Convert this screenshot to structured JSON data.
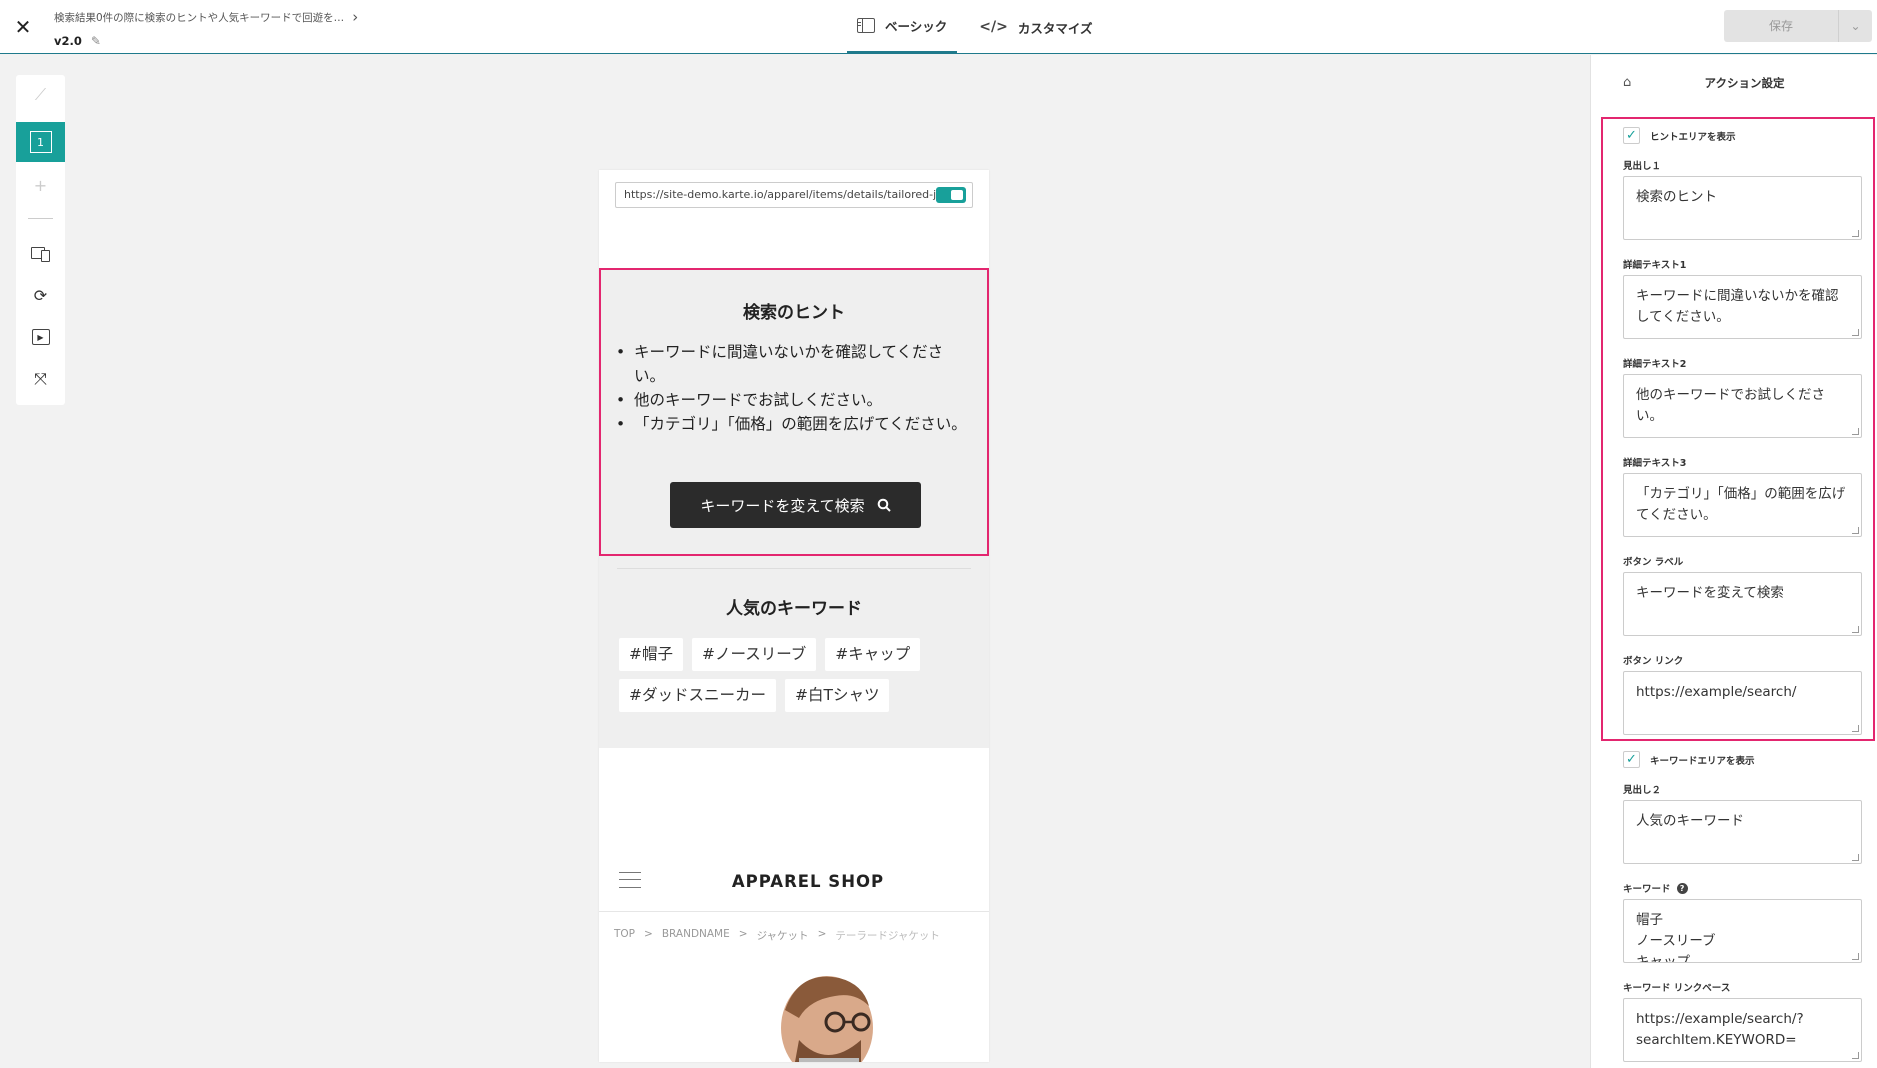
{
  "header": {
    "title": "検索結果0件の際に検索のヒントや人気キーワードで回遊を…",
    "version": "v2.0",
    "tabs": [
      {
        "label": "ベーシック",
        "active": true
      },
      {
        "label": "カスタマイズ",
        "active": false
      }
    ],
    "save_label": "保存"
  },
  "left_toolbar": {
    "active_page": "1",
    "add_label": "+"
  },
  "preview": {
    "url": "https://site-demo.karte.io/apparel/items/details/tailored-jacket",
    "hint": {
      "title": "検索のヒント",
      "items": [
        "キーワードに間違いないかを確認してください。",
        "他のキーワードでお試しください。",
        "「カテゴリ」「価格」の範囲を広げてください。"
      ],
      "button_label": "キーワードを変えて検索"
    },
    "keywords": {
      "title": "人気のキーワード",
      "tags": [
        "#帽子",
        "#ノースリーブ",
        "#キャップ",
        "#ダッドスニーカー",
        "#白Tシャツ"
      ]
    },
    "shop": {
      "logo": "APPAREL SHOP",
      "breadcrumb": [
        "TOP",
        ">",
        "BRANDNAME",
        ">",
        "ジャケット",
        ">",
        "テーラードジャケット"
      ]
    }
  },
  "settings": {
    "title": "アクション設定",
    "show_hint_label": "ヒントエリアを表示",
    "show_hint_checked": true,
    "heading1_label": "見出し１",
    "heading1_value": "検索のヒント",
    "detail1_label": "詳細テキスト1",
    "detail1_value": "キーワードに間違いないかを確認してください。",
    "detail2_label": "詳細テキスト2",
    "detail2_value": "他のキーワードでお試しください。",
    "detail3_label": "詳細テキスト3",
    "detail3_value": "「カテゴリ」「価格」の範囲を広げてください。",
    "button_label_label": "ボタン ラベル",
    "button_label_value": "キーワードを変えて検索",
    "button_link_label": "ボタン リンク",
    "button_link_value": "https://example/search/",
    "show_keyword_label": "キーワードエリアを表示",
    "show_keyword_checked": true,
    "heading2_label": "見出し２",
    "heading2_value": "人気のキーワード",
    "keywords_label": "キーワード",
    "keywords_value": "帽子\nノースリーブ\nキャップ",
    "keyword_link_label": "キーワード リンクベース",
    "keyword_link_value": "https://example/search/?searchItem.KEYWORD="
  },
  "colors": {
    "accent": "#18a09a",
    "highlight": "#e3266f",
    "button_dark": "#2b2b2b"
  }
}
